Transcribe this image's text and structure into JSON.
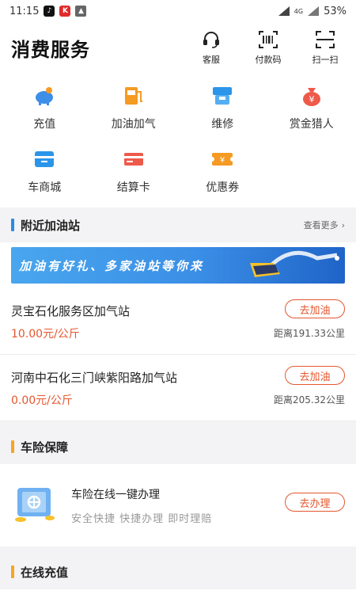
{
  "status_bar": {
    "time": "11:15",
    "network": "4G",
    "battery": "53%"
  },
  "header": {
    "title": "消费服务",
    "actions": [
      {
        "label": "客服",
        "icon": "headset-icon"
      },
      {
        "label": "付款码",
        "icon": "barcode-icon"
      },
      {
        "label": "扫一扫",
        "icon": "scan-icon"
      }
    ]
  },
  "services": [
    {
      "label": "充值",
      "icon": "piggy-bank-icon",
      "color": "#3d8ee8"
    },
    {
      "label": "加油加气",
      "icon": "fuel-pump-icon",
      "color": "#f59a23"
    },
    {
      "label": "维修",
      "icon": "repair-icon",
      "color": "#2b95e9"
    },
    {
      "label": "赏金猎人",
      "icon": "money-bag-icon",
      "color": "#ee5a4a"
    },
    {
      "label": "车商城",
      "icon": "store-icon",
      "color": "#2b95e9"
    },
    {
      "label": "结算卡",
      "icon": "card-icon",
      "color": "#ee5a4a"
    },
    {
      "label": "优惠券",
      "icon": "coupon-icon",
      "color": "#f59a23"
    }
  ],
  "nearby": {
    "title": "附近加油站",
    "more": "查看更多",
    "accent": "#2b8be6",
    "banner_text": "加油有好礼、多家油站等你来",
    "stations": [
      {
        "name": "灵宝石化服务区加气站",
        "price": "10.00元/公斤",
        "distance": "距离191.33公里",
        "button": "去加油"
      },
      {
        "name": "河南中石化三门峡紫阳路加气站",
        "price": "0.00元/公斤",
        "distance": "距离205.32公里",
        "button": "去加油"
      }
    ]
  },
  "insurance": {
    "title": "车险保障",
    "accent": "#f5a623",
    "item_title": "车险在线一键办理",
    "item_sub": "安全快捷 快捷办理 即时理赔",
    "button": "去办理"
  },
  "recharge": {
    "title": "在线充值",
    "accent": "#f5a623"
  }
}
